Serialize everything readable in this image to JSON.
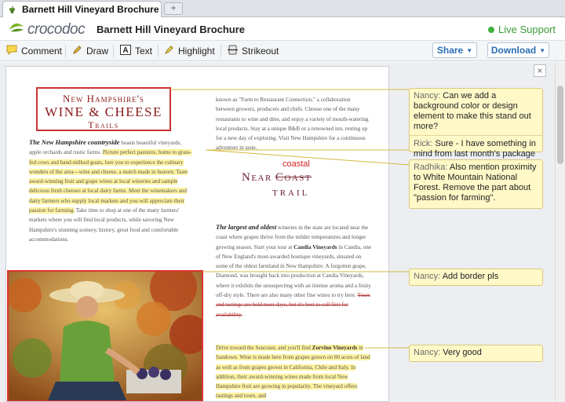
{
  "browser": {
    "tab_title": "Barnett Hill Vineyard Brochure",
    "new_tab_symbol": "+"
  },
  "header": {
    "logo_text": "crocodoc",
    "doc_title": "Barnett Hill Vineyard Brochure",
    "live_support": "Live Support"
  },
  "toolbar": {
    "comment": "Comment",
    "draw": "Draw",
    "text": "Text",
    "highlight": "Highlight",
    "strikeout": "Strikeout",
    "share": "Share",
    "download": "Download"
  },
  "page": {
    "title_line1": "New Hampshire's",
    "title_line2": "WINE & CHEESE",
    "title_line3": "Trails",
    "left_lead": "The New Hampshire countryside",
    "left_text1": " boasts beautiful vineyards, apple orchards and rustic farms. ",
    "left_hl": "Picture perfect pastures, home to grass-fed cows and hand-milked goats, lure you to experience the culinary wonders of the area—wine and cheese, a match made in heaven. Taste award-winning fruit and grape wines at local wineries and sample delicious fresh cheeses at local dairy farms. Meet the winemakers and dairy farmers who supply local markets and you will appreciate their passion for farming.",
    "left_text2": " Take time to shop at one of the many farmers' markets where you will find local products, while savoring New Hampshire's stunning scenery, history, great food and comfortable accommodations.",
    "right_text1": "known as \"Farm to Restaurant Connection,\" a collaboration between growers, producers and chefs. Choose one of the many restaurants to wine and dine, and enjoy a variety of mouth-watering local products. Stay at a unique B&B or a renowned inn, resting up for a new day of exploring. Visit New Hampshire for a continuous adventure in taste.",
    "near": "Near",
    "coast": "Coast",
    "coastal": "coastal",
    "trail": "TRAIL",
    "right_lead": "The largest and oldest",
    "right_text2": " wineries in the state are located near the coast where grapes thrive from the milder temperatures and longer growing season. Start your tour at ",
    "right_bold1": "Candia Vineyards",
    "right_text3": " in Candia, one of New England's most-awarded boutique vineyards, situated on some of the oldest farmland in New Hampshire. A forgotten grape, Diamond, was brought back into production at Candia Vineyards, where it exhibits the unsuspecting with an intense aroma and a fruity off-dry style. There are also many other fine wines to try here. ",
    "right_strike": "Tours and tastings are held most days, but it's best to call first for availability.",
    "right_hl1": "Drive toward the Seacoast, and you'll find ",
    "right_bold2": "Zorvino Vineyards",
    "right_hl2": " in Sandown. Wine is made here from grapes grown on 80 acres of land as well as from grapes grown in California, Chile and Italy. In addition, their award-winning wines made from local New Hampshire fruit are growing in popularity. The vineyard offers tastings and tours, and"
  },
  "comments": [
    {
      "author": "Nancy:",
      "text": " Can we add a background color or design element to make this stand out more?"
    },
    {
      "author": "Rick:",
      "text": " Sure - I have something in mind from last month's package"
    },
    {
      "author": "Radhika:",
      "text": " Also mention proximity to White Mountain National Forest.  Remove the part about \"passion for farming\"."
    },
    {
      "author": "Nancy:",
      "text": " Add border pls"
    },
    {
      "author": "Nancy:",
      "text": " Very good"
    }
  ],
  "close_symbol": "×",
  "colors": {
    "accent": "#2a6db5",
    "live": "#3a9a3a",
    "highlight": "#fff3a0",
    "comment_bg": "#fff9c8",
    "title_red": "#c33"
  }
}
